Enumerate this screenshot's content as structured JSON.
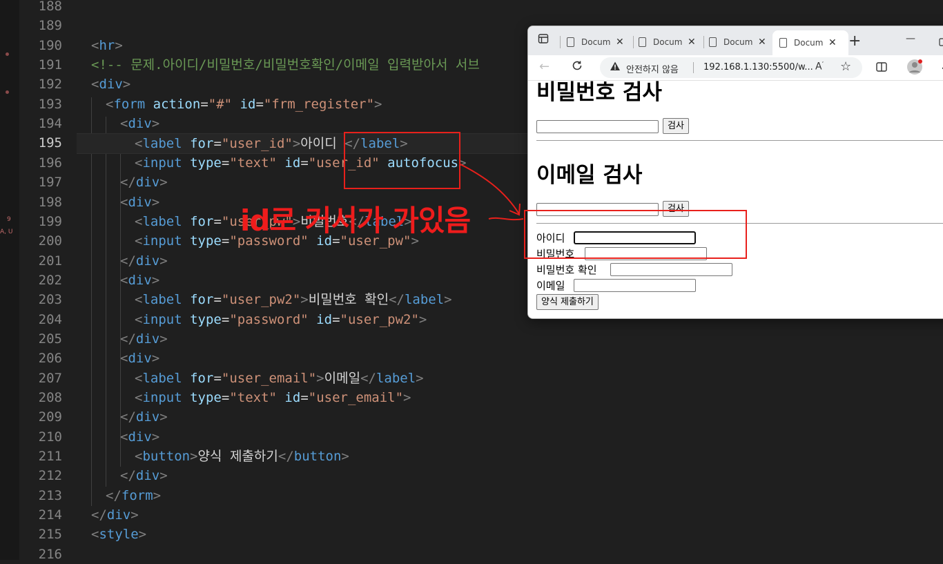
{
  "editor": {
    "active_line": 195,
    "side_marks": [
      "9",
      "A, U"
    ],
    "lines": [
      {
        "n": 188,
        "tokens": []
      },
      {
        "n": 189,
        "tokens": []
      },
      {
        "n": 190,
        "indent": 1,
        "tokens": [
          [
            "t",
            "<"
          ],
          [
            "tg",
            "hr"
          ],
          [
            "t",
            ">"
          ]
        ]
      },
      {
        "n": 191,
        "indent": 1,
        "tokens": [
          [
            "cm",
            "<!-- 문제.아이디/비밀번호/비밀번호확인/이메일 입력받아서 서브"
          ]
        ]
      },
      {
        "n": 192,
        "indent": 1,
        "tokens": [
          [
            "t",
            "<"
          ],
          [
            "tg",
            "div"
          ],
          [
            "t",
            ">"
          ]
        ]
      },
      {
        "n": 193,
        "indent": 2,
        "tokens": [
          [
            "t",
            "<"
          ],
          [
            "tg",
            "form"
          ],
          [
            "tx",
            " "
          ],
          [
            "at",
            "action"
          ],
          [
            "tx",
            "="
          ],
          [
            "s",
            "\"#\""
          ],
          [
            "tx",
            " "
          ],
          [
            "at",
            "id"
          ],
          [
            "tx",
            "="
          ],
          [
            "s",
            "\"frm_register\""
          ],
          [
            "t",
            ">"
          ]
        ]
      },
      {
        "n": 194,
        "indent": 3,
        "tokens": [
          [
            "t",
            "<"
          ],
          [
            "tg",
            "div"
          ],
          [
            "t",
            ">"
          ]
        ]
      },
      {
        "n": 195,
        "indent": 4,
        "tokens": [
          [
            "t",
            "<"
          ],
          [
            "tg",
            "label"
          ],
          [
            "tx",
            " "
          ],
          [
            "at",
            "for"
          ],
          [
            "tx",
            "="
          ],
          [
            "s",
            "\"user_id\""
          ],
          [
            "t",
            ">"
          ],
          [
            "tx",
            "아이디 "
          ],
          [
            "t",
            "</"
          ],
          [
            "tg",
            "label"
          ],
          [
            "t",
            ">"
          ]
        ]
      },
      {
        "n": 196,
        "indent": 4,
        "tokens": [
          [
            "t",
            "<"
          ],
          [
            "tg",
            "input"
          ],
          [
            "tx",
            " "
          ],
          [
            "at",
            "type"
          ],
          [
            "tx",
            "="
          ],
          [
            "s",
            "\"text\""
          ],
          [
            "tx",
            " "
          ],
          [
            "at",
            "id"
          ],
          [
            "tx",
            "="
          ],
          [
            "s",
            "\"user_id\""
          ],
          [
            "tx",
            " "
          ],
          [
            "at",
            "autofocus"
          ],
          [
            "t",
            ">"
          ]
        ]
      },
      {
        "n": 197,
        "indent": 3,
        "tokens": [
          [
            "t",
            "</"
          ],
          [
            "tg",
            "div"
          ],
          [
            "t",
            ">"
          ]
        ]
      },
      {
        "n": 198,
        "indent": 3,
        "tokens": [
          [
            "t",
            "<"
          ],
          [
            "tg",
            "div"
          ],
          [
            "t",
            ">"
          ]
        ]
      },
      {
        "n": 199,
        "indent": 4,
        "tokens": [
          [
            "t",
            "<"
          ],
          [
            "tg",
            "label"
          ],
          [
            "tx",
            " "
          ],
          [
            "at",
            "for"
          ],
          [
            "tx",
            "="
          ],
          [
            "s",
            "\"user_pw\""
          ],
          [
            "t",
            ">"
          ],
          [
            "tx",
            "비밀번호"
          ],
          [
            "t",
            "</"
          ],
          [
            "tg",
            "label"
          ],
          [
            "t",
            ">"
          ]
        ]
      },
      {
        "n": 200,
        "indent": 4,
        "tokens": [
          [
            "t",
            "<"
          ],
          [
            "tg",
            "input"
          ],
          [
            "tx",
            " "
          ],
          [
            "at",
            "type"
          ],
          [
            "tx",
            "="
          ],
          [
            "s",
            "\"password\""
          ],
          [
            "tx",
            " "
          ],
          [
            "at",
            "id"
          ],
          [
            "tx",
            "="
          ],
          [
            "s",
            "\"user_pw\""
          ],
          [
            "t",
            ">"
          ]
        ]
      },
      {
        "n": 201,
        "indent": 3,
        "tokens": [
          [
            "t",
            "</"
          ],
          [
            "tg",
            "div"
          ],
          [
            "t",
            ">"
          ]
        ]
      },
      {
        "n": 202,
        "indent": 3,
        "tokens": [
          [
            "t",
            "<"
          ],
          [
            "tg",
            "div"
          ],
          [
            "t",
            ">"
          ]
        ]
      },
      {
        "n": 203,
        "indent": 4,
        "tokens": [
          [
            "t",
            "<"
          ],
          [
            "tg",
            "label"
          ],
          [
            "tx",
            " "
          ],
          [
            "at",
            "for"
          ],
          [
            "tx",
            "="
          ],
          [
            "s",
            "\"user_pw2\""
          ],
          [
            "t",
            ">"
          ],
          [
            "tx",
            "비밀번호 확인"
          ],
          [
            "t",
            "</"
          ],
          [
            "tg",
            "label"
          ],
          [
            "t",
            ">"
          ]
        ]
      },
      {
        "n": 204,
        "indent": 4,
        "tokens": [
          [
            "t",
            "<"
          ],
          [
            "tg",
            "input"
          ],
          [
            "tx",
            " "
          ],
          [
            "at",
            "type"
          ],
          [
            "tx",
            "="
          ],
          [
            "s",
            "\"password\""
          ],
          [
            "tx",
            " "
          ],
          [
            "at",
            "id"
          ],
          [
            "tx",
            "="
          ],
          [
            "s",
            "\"user_pw2\""
          ],
          [
            "t",
            ">"
          ]
        ]
      },
      {
        "n": 205,
        "indent": 3,
        "tokens": [
          [
            "t",
            "</"
          ],
          [
            "tg",
            "div"
          ],
          [
            "t",
            ">"
          ]
        ]
      },
      {
        "n": 206,
        "indent": 3,
        "tokens": [
          [
            "t",
            "<"
          ],
          [
            "tg",
            "div"
          ],
          [
            "t",
            ">"
          ]
        ]
      },
      {
        "n": 207,
        "indent": 4,
        "tokens": [
          [
            "t",
            "<"
          ],
          [
            "tg",
            "label"
          ],
          [
            "tx",
            " "
          ],
          [
            "at",
            "for"
          ],
          [
            "tx",
            "="
          ],
          [
            "s",
            "\"user_email\""
          ],
          [
            "t",
            ">"
          ],
          [
            "tx",
            "이메일"
          ],
          [
            "t",
            "</"
          ],
          [
            "tg",
            "label"
          ],
          [
            "t",
            ">"
          ]
        ]
      },
      {
        "n": 208,
        "indent": 4,
        "tokens": [
          [
            "t",
            "<"
          ],
          [
            "tg",
            "input"
          ],
          [
            "tx",
            " "
          ],
          [
            "at",
            "type"
          ],
          [
            "tx",
            "="
          ],
          [
            "s",
            "\"text\""
          ],
          [
            "tx",
            " "
          ],
          [
            "at",
            "id"
          ],
          [
            "tx",
            "="
          ],
          [
            "s",
            "\"user_email\""
          ],
          [
            "t",
            ">"
          ]
        ]
      },
      {
        "n": 209,
        "indent": 3,
        "tokens": [
          [
            "t",
            "</"
          ],
          [
            "tg",
            "div"
          ],
          [
            "t",
            ">"
          ]
        ]
      },
      {
        "n": 210,
        "indent": 3,
        "tokens": [
          [
            "t",
            "<"
          ],
          [
            "tg",
            "div"
          ],
          [
            "t",
            ">"
          ]
        ]
      },
      {
        "n": 211,
        "indent": 4,
        "tokens": [
          [
            "t",
            "<"
          ],
          [
            "tg",
            "button"
          ],
          [
            "t",
            ">"
          ],
          [
            "tx",
            "양식 제출하기"
          ],
          [
            "t",
            "</"
          ],
          [
            "tg",
            "button"
          ],
          [
            "t",
            ">"
          ]
        ]
      },
      {
        "n": 212,
        "indent": 3,
        "tokens": [
          [
            "t",
            "</"
          ],
          [
            "tg",
            "div"
          ],
          [
            "t",
            ">"
          ]
        ]
      },
      {
        "n": 213,
        "indent": 2,
        "tokens": [
          [
            "t",
            "</"
          ],
          [
            "tg",
            "form"
          ],
          [
            "t",
            ">"
          ]
        ]
      },
      {
        "n": 214,
        "indent": 1,
        "tokens": [
          [
            "t",
            "</"
          ],
          [
            "tg",
            "div"
          ],
          [
            "t",
            ">"
          ]
        ]
      },
      {
        "n": 215,
        "indent": 1,
        "tokens": [
          [
            "t",
            "<"
          ],
          [
            "tg",
            "style"
          ],
          [
            "t",
            ">"
          ]
        ]
      },
      {
        "n": 216,
        "tokens": []
      }
    ]
  },
  "browser": {
    "tabs": [
      {
        "title": "Docum",
        "active": false
      },
      {
        "title": "Docum",
        "active": false
      },
      {
        "title": "Docum",
        "active": false
      },
      {
        "title": "Docum",
        "active": true
      }
    ],
    "new_tab_symbol": "+",
    "minimize_symbol": "—",
    "security_text": "안전하지 않음",
    "url": "192.168.1.130:5500/w...",
    "page": {
      "heading_password": "비밀번호 검사",
      "check_button": "검사",
      "heading_email": "이메일 검사",
      "check_button_2": "검사",
      "labels": {
        "user_id": "아이디",
        "user_pw": "비밀번호",
        "user_pw2": "비밀번호 확인",
        "user_email": "이메일"
      },
      "submit_button": "양식 제출하기"
    }
  },
  "annotation": {
    "text": "id로 커서가 가있음",
    "color": "#e8201b"
  }
}
